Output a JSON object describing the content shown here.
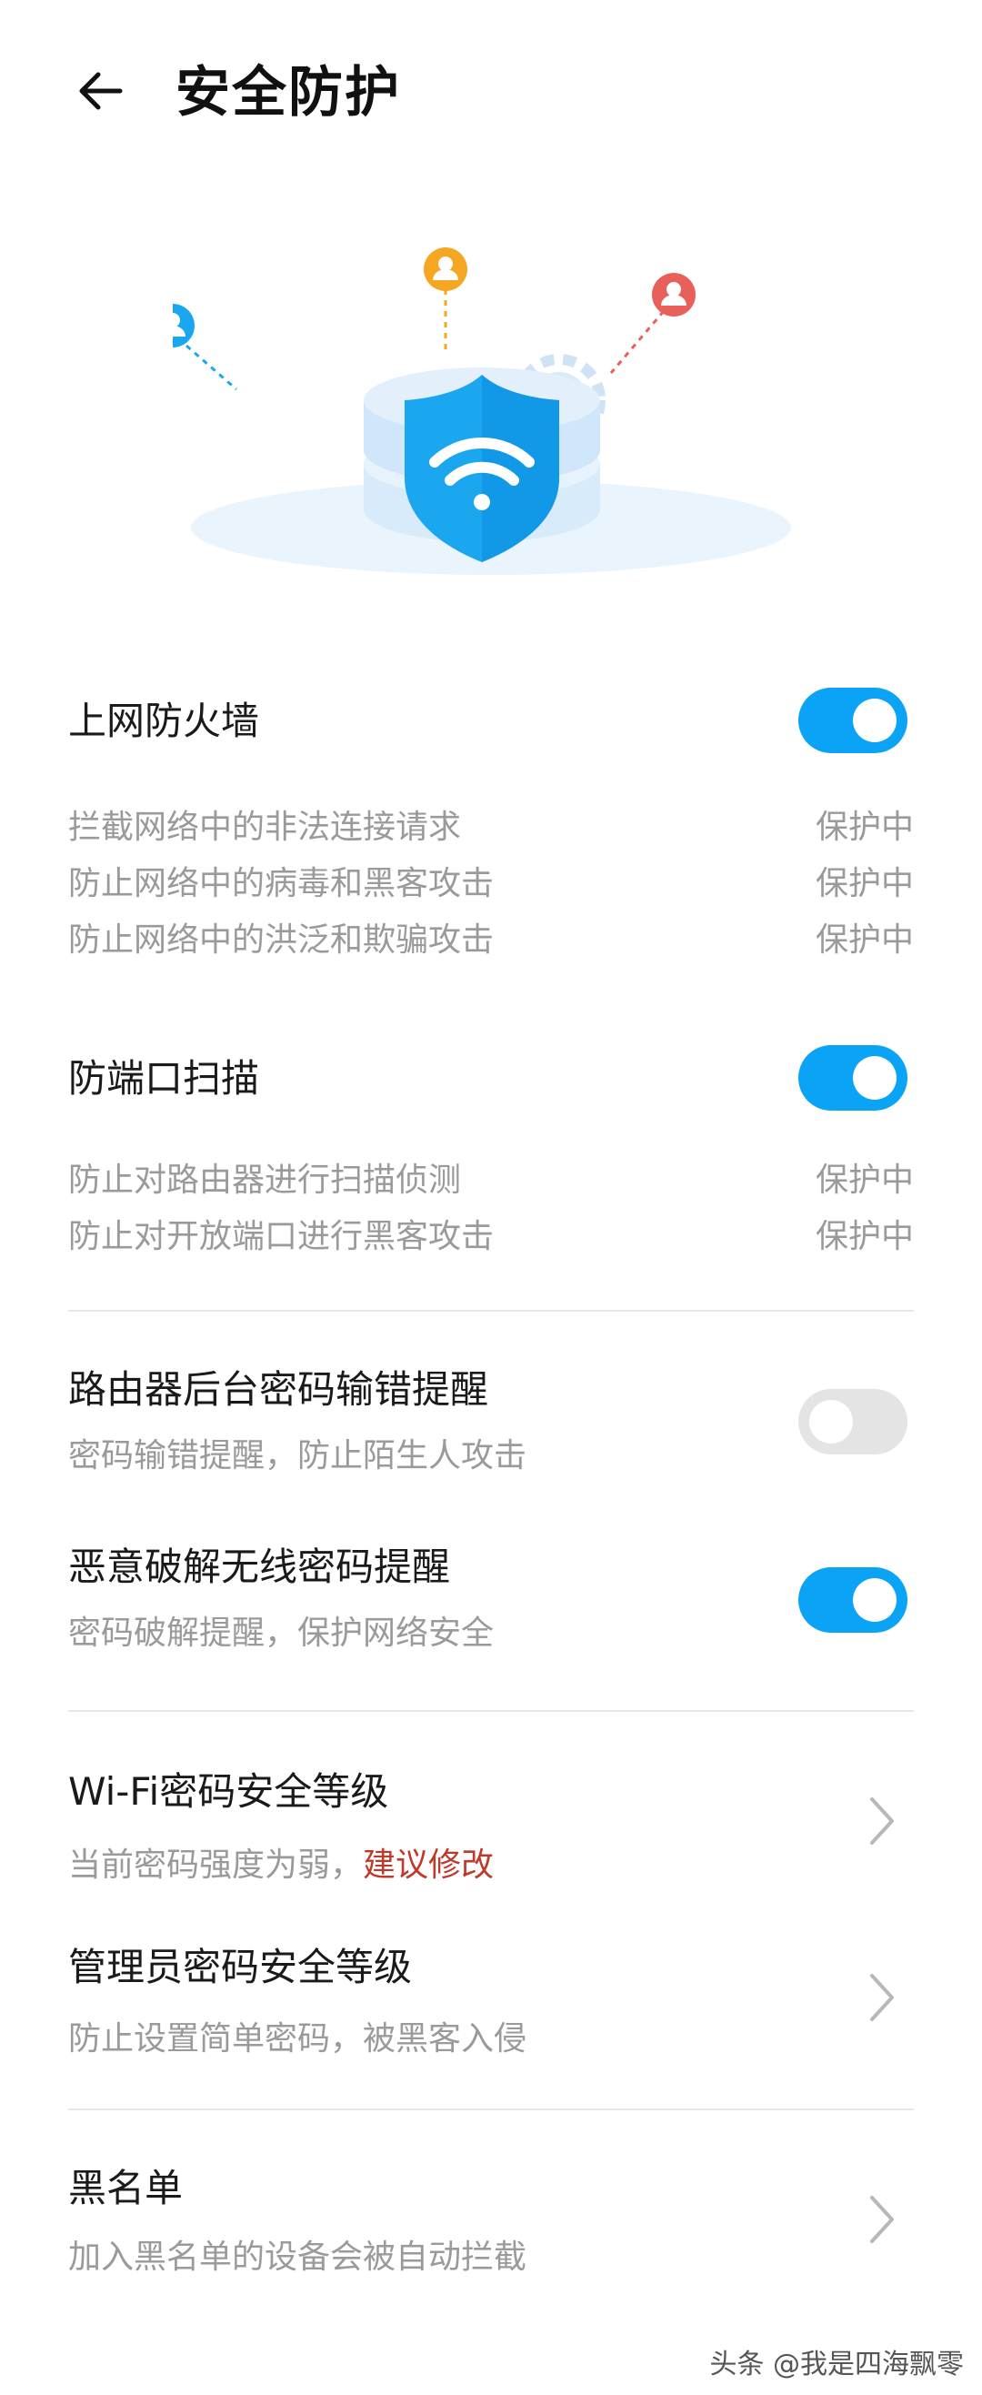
{
  "header": {
    "title": "安全防护"
  },
  "firewall": {
    "title": "上网防火墙",
    "enabled": true,
    "items": [
      {
        "text": "拦截网络中的非法连接请求",
        "status": "保护中"
      },
      {
        "text": "防止网络中的病毒和黑客攻击",
        "status": "保护中"
      },
      {
        "text": "防止网络中的洪泛和欺骗攻击",
        "status": "保护中"
      }
    ]
  },
  "port_scan": {
    "title": "防端口扫描",
    "enabled": true,
    "items": [
      {
        "text": "防止对路由器进行扫描侦测",
        "status": "保护中"
      },
      {
        "text": "防止对开放端口进行黑客攻击",
        "status": "保护中"
      }
    ]
  },
  "router_pwd_alert": {
    "title": "路由器后台密码输错提醒",
    "desc": "密码输错提醒，防止陌生人攻击",
    "enabled": false
  },
  "crack_alert": {
    "title": "恶意破解无线密码提醒",
    "desc": "密码破解提醒，保护网络安全",
    "enabled": true
  },
  "wifi_level": {
    "title": "Wi-Fi密码安全等级",
    "desc": "当前密码强度为弱，",
    "action": "建议修改"
  },
  "admin_level": {
    "title": "管理员密码安全等级",
    "desc": "防止设置简单密码，被黑客入侵"
  },
  "blacklist": {
    "title": "黑名单",
    "desc": "加入黑名单的设备会被自动拦截"
  },
  "watermark": "头条 @我是四海飘零",
  "colors": {
    "accent": "#0aa3f5",
    "warning": "#c0392b",
    "muted": "#9a9a9a"
  },
  "icons": {
    "back": "arrow-left-icon",
    "chevron": "chevron-right-icon",
    "illustration": "shield-wifi-illustration"
  }
}
